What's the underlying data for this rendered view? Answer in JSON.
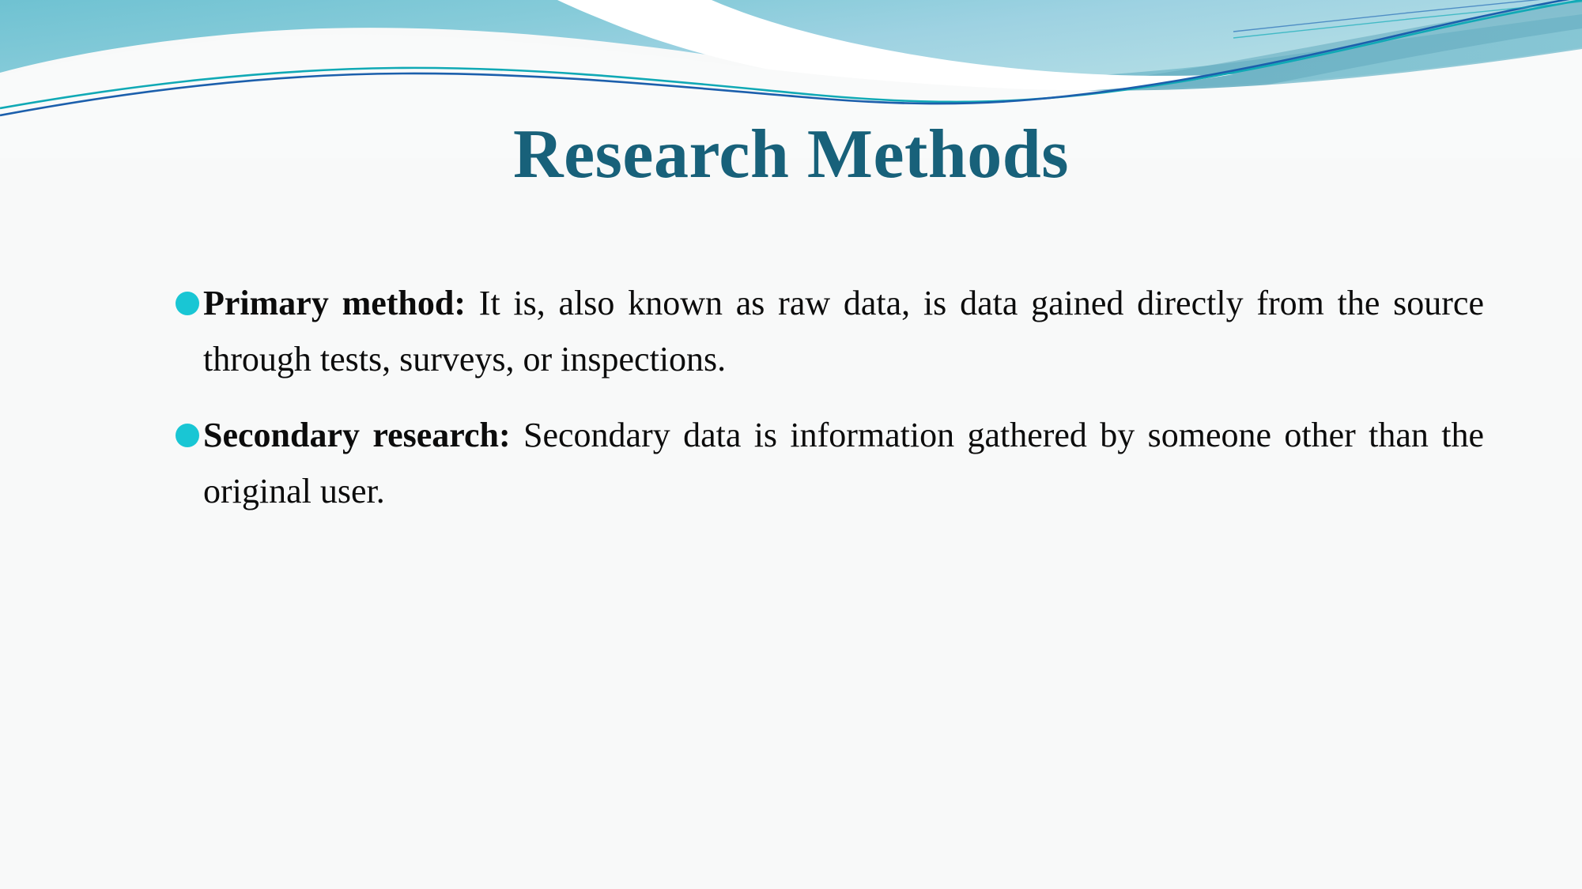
{
  "slide": {
    "title": "Research Methods",
    "title_color": "#18617A",
    "background_color": "#F8F9F9",
    "bullet_color": "#19C6D4",
    "body_text_color": "#0C0C0C"
  },
  "header_decoration": {
    "name": "wave-banner",
    "colors": {
      "teal_fill_top": "#7FC6D4",
      "teal_fill_bottom": "#8FC9DE",
      "teal_ribbon": "#69AEC0",
      "white_band": "#FFFFFF",
      "line_teal": "#0FA9B4",
      "line_navy": "#1B5FAE"
    }
  },
  "bullets": [
    {
      "lead": "Primary method:",
      "rest": " It is, also known as raw data, is data gained directly from the source through tests, surveys, or inspections."
    },
    {
      "lead": "Secondary research:",
      "rest": " Secondary data is information gathered by someone other than the original user."
    }
  ]
}
